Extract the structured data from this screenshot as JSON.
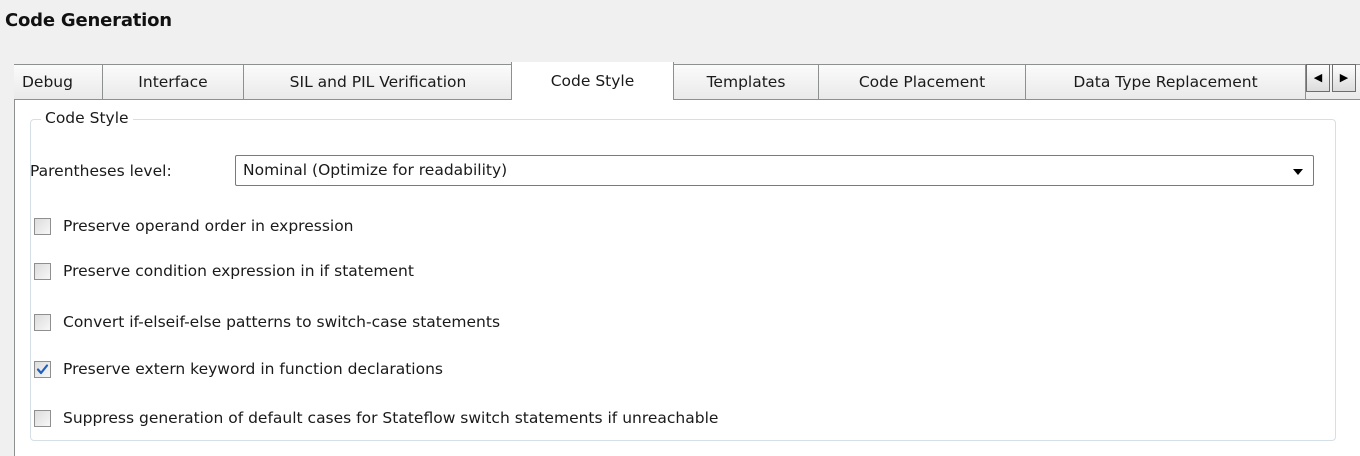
{
  "panel": {
    "title": "Code Generation"
  },
  "tabs": [
    {
      "label": "Debug",
      "active": false
    },
    {
      "label": "Interface",
      "active": false
    },
    {
      "label": "SIL and PIL Verification",
      "active": false
    },
    {
      "label": "Code Style",
      "active": true
    },
    {
      "label": "Templates",
      "active": false
    },
    {
      "label": "Code Placement",
      "active": false
    },
    {
      "label": "Data Type Replacement",
      "active": false
    }
  ],
  "tab_scroll": {
    "left_icon": "arrow-left-icon",
    "right_icon": "arrow-right-icon"
  },
  "group": {
    "title": "Code Style",
    "parentheses": {
      "label": "Parentheses level:",
      "value": "Nominal (Optimize for readability)"
    },
    "checkboxes": [
      {
        "label": "Preserve operand order in expression",
        "checked": false
      },
      {
        "label": "Preserve condition expression in if statement",
        "checked": false
      },
      {
        "label": "Convert if-elseif-else patterns to switch-case statements",
        "checked": false
      },
      {
        "label": "Preserve extern keyword in function declarations",
        "checked": true
      },
      {
        "label": "Suppress generation of default cases for Stateflow switch statements if unreachable",
        "checked": false
      }
    ]
  },
  "colors": {
    "check_mark": "#1f5fbf",
    "tab_border": "#8e8f8f",
    "group_border": "#d5dfe5"
  }
}
